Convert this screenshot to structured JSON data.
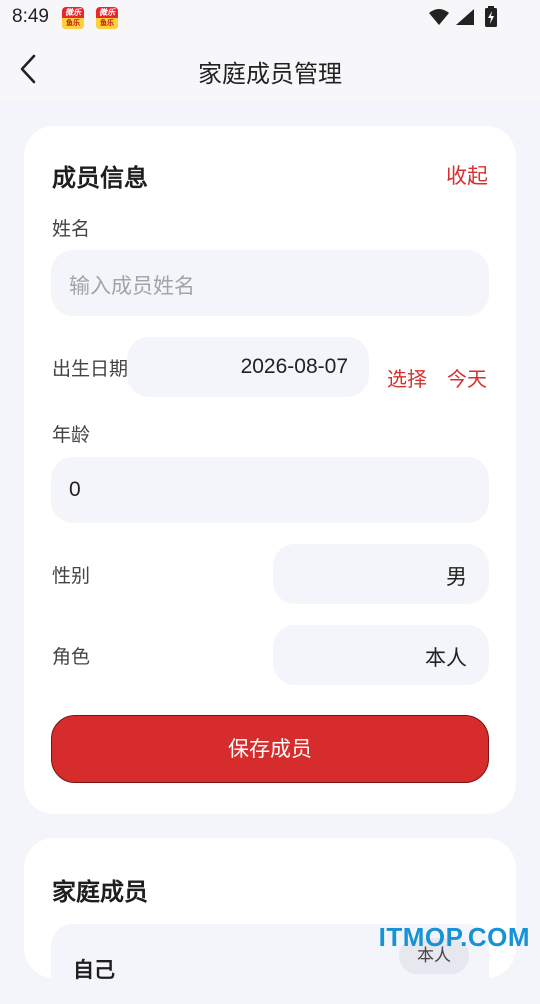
{
  "status_bar": {
    "time": "8:49",
    "badge_text_top": "微乐",
    "badge_text_bottom": "鱼乐"
  },
  "app_bar": {
    "title": "家庭成员管理",
    "back_icon": "chevron-left-icon"
  },
  "member_form": {
    "section_title": "成员信息",
    "collapse_label": "收起",
    "name_label": "姓名",
    "name_placeholder": "输入成员姓名",
    "name_value": "",
    "birth_label": "出生日期",
    "birth_value": "2026-08-07",
    "select_label": "选择",
    "today_label": "今天",
    "age_label": "年龄",
    "age_value": "0",
    "gender_label": "性别",
    "gender_value": "男",
    "role_label": "角色",
    "role_value": "本人",
    "save_label": "保存成员"
  },
  "family_list": {
    "section_title": "家庭成员",
    "members": [
      {
        "name": "自己",
        "role": "本人"
      }
    ]
  },
  "watermark": "ITMOP.COM",
  "colors": {
    "accent_red": "#d62c2c",
    "link_red": "#d63031",
    "background": "#f4f5fa",
    "watermark_blue": "#1593d6"
  }
}
